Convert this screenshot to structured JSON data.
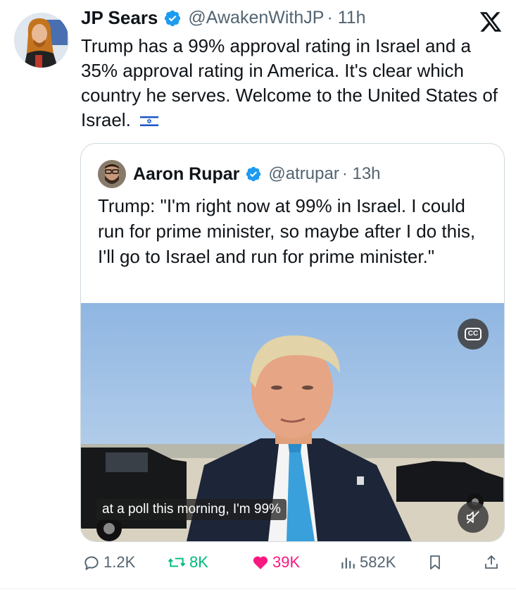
{
  "tweet": {
    "author_name": "JP Sears",
    "author_handle": "@AwakenWithJP",
    "time": "· 11h",
    "text": "Trump has a 99% approval rating in Israel and a 35% approval rating in America. It's clear which country he serves. Welcome to the United States of Israel."
  },
  "quoted": {
    "author_name": "Aaron Rupar",
    "author_handle": "@atrupar",
    "time": "· 13h",
    "text": "Trump: \"I'm right now at 99% in Israel. I could run for prime minister, so maybe after I do this, I'll go to Israel and run for prime minister.\"",
    "video": {
      "caption": "at a poll this morning, I'm 99%",
      "cc_label": "CC"
    }
  },
  "actions": {
    "replies": "1.2K",
    "reposts": "8K",
    "likes": "39K",
    "views": "582K"
  },
  "colors": {
    "verified": "#1d9bf0",
    "muted": "#536471",
    "repost": "#00ba7c",
    "like": "#f91880"
  },
  "icons": [
    "verified-badge-icon",
    "x-logo-icon",
    "israel-flag-icon",
    "cc-icon",
    "mute-icon",
    "reply-icon",
    "repost-icon",
    "like-icon",
    "views-icon",
    "bookmark-icon",
    "share-icon"
  ]
}
